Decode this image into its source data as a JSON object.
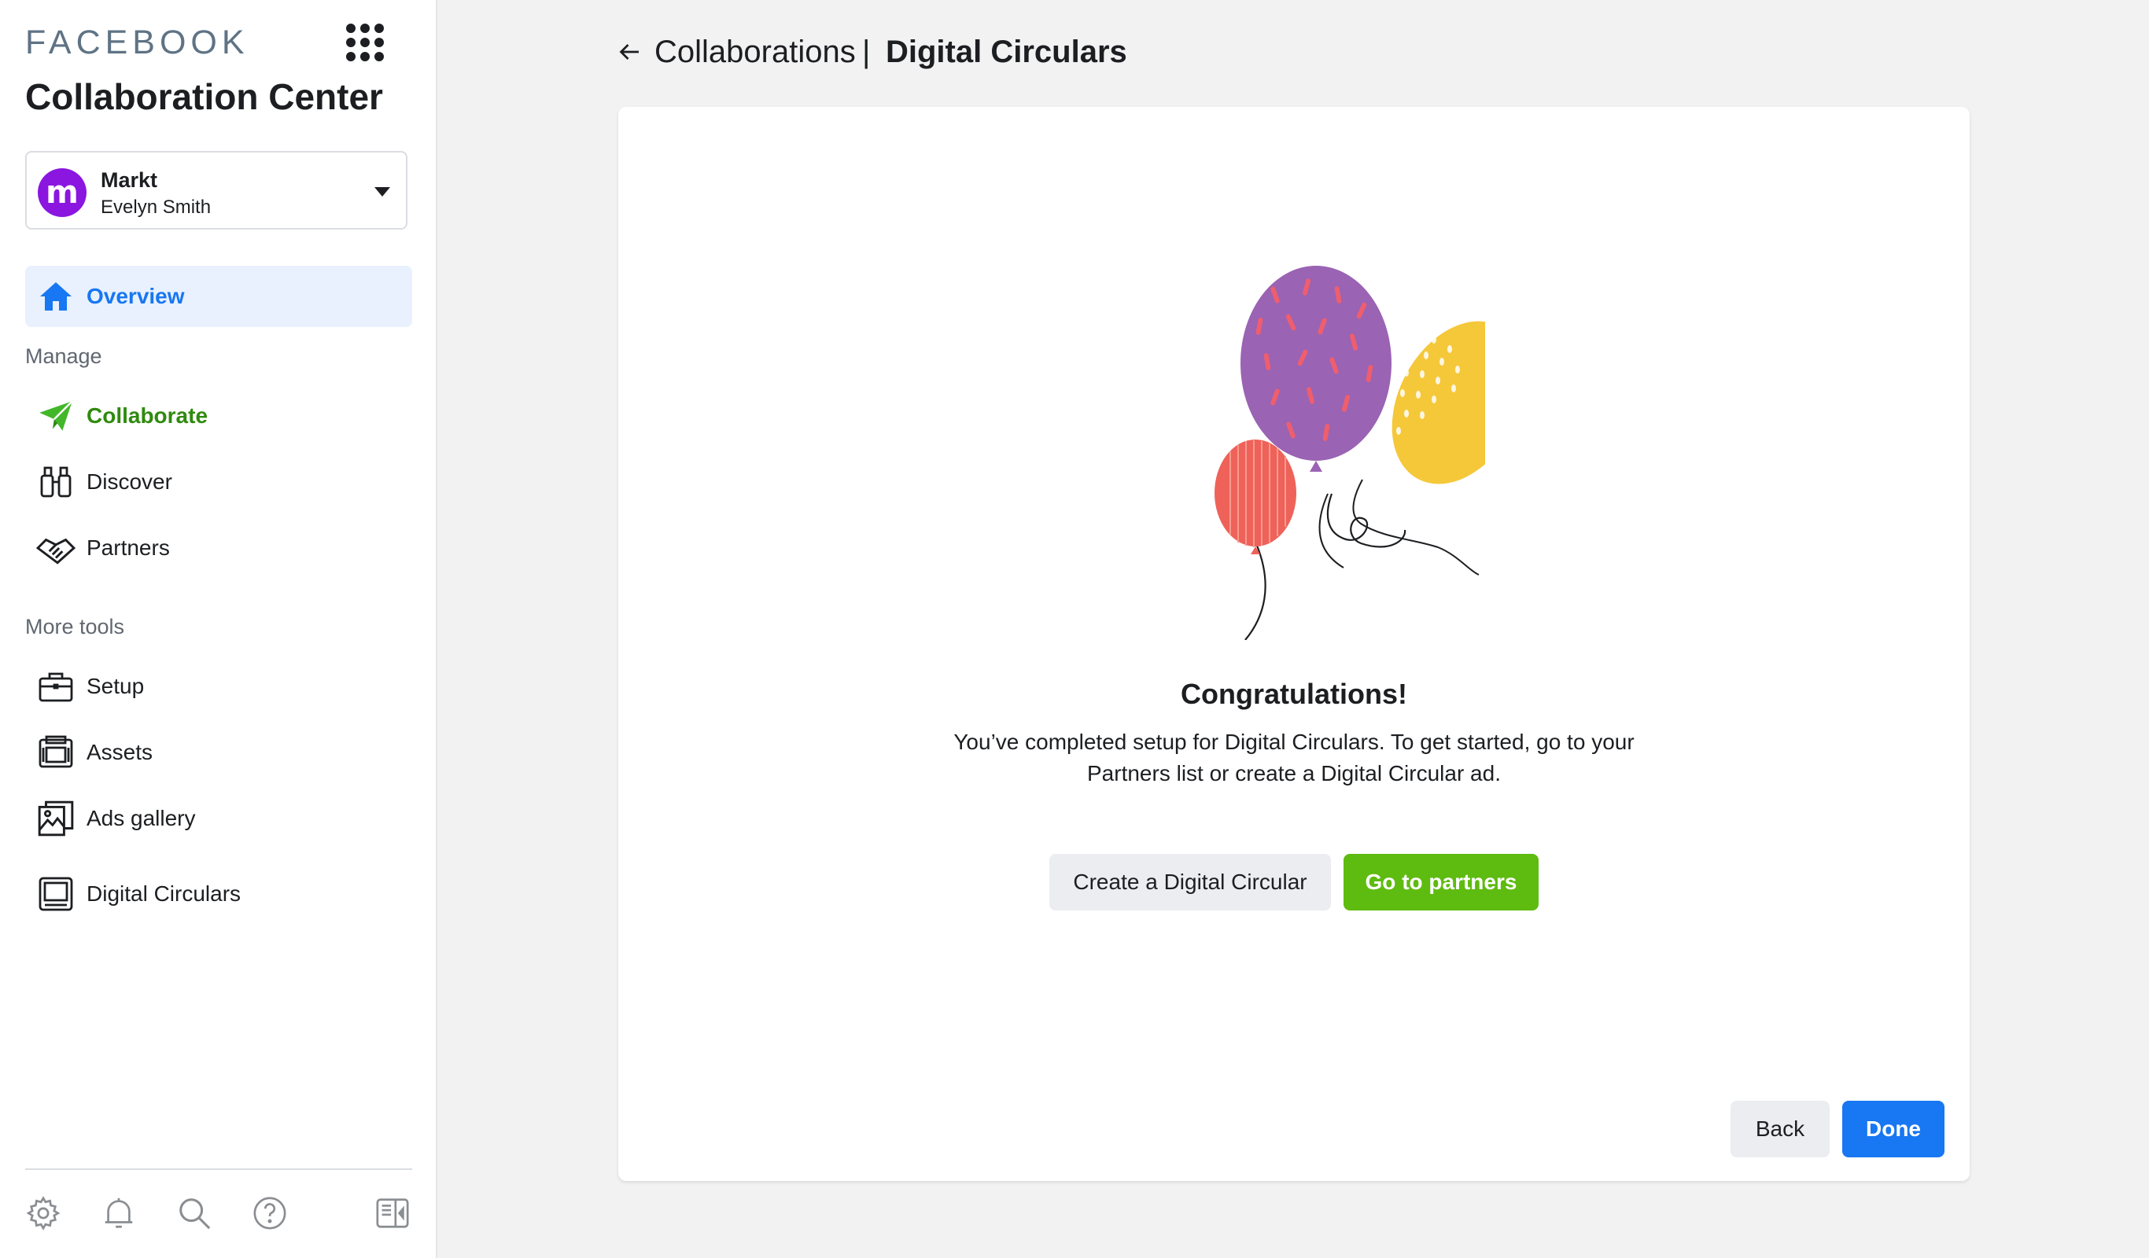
{
  "sidebar": {
    "brand_word": "FACEBOOK",
    "product_name": "Collaboration Center",
    "account": {
      "initial": "m",
      "name": "Markt",
      "user": "Evelyn Smith",
      "avatar_color": "#8a16e0"
    },
    "overview": {
      "label": "Overview",
      "icon": "home-icon"
    },
    "manage_label": "Manage",
    "manage_items": [
      {
        "label": "Collaborate",
        "icon": "paper-plane-icon"
      },
      {
        "label": "Discover",
        "icon": "binoculars-icon"
      },
      {
        "label": "Partners",
        "icon": "handshake-icon"
      }
    ],
    "more_tools_label": "More tools",
    "more_tools_items": [
      {
        "label": "Setup",
        "icon": "briefcase-icon"
      },
      {
        "label": "Assets",
        "icon": "assets-icon"
      },
      {
        "label": "Ads gallery",
        "icon": "image-gallery-icon"
      },
      {
        "label": "Digital Circulars",
        "icon": "monitor-icon"
      }
    ],
    "bottom_icons": [
      "gear-icon",
      "bell-icon",
      "search-icon",
      "help-icon",
      "collapse-panel-icon"
    ]
  },
  "header": {
    "parent": "Collaborations",
    "separator": "|",
    "current": "Digital Circulars"
  },
  "card": {
    "title": "Congratulations!",
    "body": "You’ve completed setup for Digital Circulars. To get started, go to your Partners list or create a Digital Circular ad.",
    "create_button": "Create a Digital Circular",
    "partners_button": "Go to partners",
    "back_button": "Back",
    "done_button": "Done"
  },
  "colors": {
    "accent_blue": "#1877f2",
    "accent_green": "#5ebb10",
    "collaborate_green": "#2f8a0f",
    "balloon_purple": "#9a63b3",
    "balloon_yellow": "#f5c83a",
    "balloon_red": "#ee6259"
  }
}
